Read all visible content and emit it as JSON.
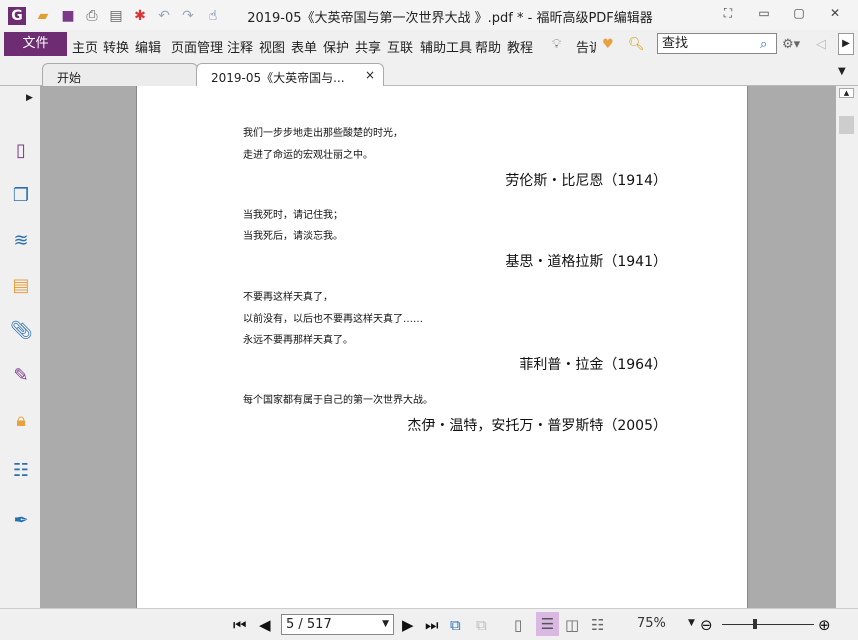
{
  "window": {
    "title": "2019-05《大英帝国与第一次世界大战 》.pdf * - 福昕高级PDF编辑器"
  },
  "quick_access": [
    "app-logo-icon",
    "open-icon",
    "save-icon",
    "print-icon",
    "properties-icon",
    "new-icon",
    "undo-icon",
    "redo-icon",
    "hand-tool-icon"
  ],
  "menu": {
    "file": "文件",
    "items": [
      "主页",
      "转换",
      "编辑",
      "页面管理",
      "注释",
      "视图",
      "表单",
      "保护",
      "共享",
      "互联",
      "辅助工具",
      "帮助",
      "教程"
    ],
    "tell": "告诉",
    "search_placeholder": "查找"
  },
  "tabs": [
    {
      "label": "开始"
    },
    {
      "label": "2019-05《大英帝国与...",
      "close": "×"
    }
  ],
  "sidebar": [
    "page-thumbnail-icon",
    "pages-icon",
    "layers-icon",
    "comments-icon",
    "attachments-icon",
    "signature-icon",
    "security-icon",
    "form-fields-icon",
    "certify-icon"
  ],
  "content": {
    "blocks": [
      {
        "lines": [
          "我们一步步地走出那些酸楚的时光，",
          "走进了命运的宏观壮丽之中。"
        ],
        "author": "劳伦斯・比尼恩（1914）"
      },
      {
        "lines": [
          "当我死时，请记住我；",
          "当我死后，请淡忘我。"
        ],
        "author": "基思・道格拉斯（1941）"
      },
      {
        "lines": [
          "不要再这样天真了，",
          "以前没有，以后也不要再这样天真了……",
          "永远不要再那样天真了。"
        ],
        "author": "菲利普・拉金（1964）"
      },
      {
        "lines": [
          "每个国家都有属于自己的第一次世界大战。"
        ],
        "author": "杰伊・温特，安托万・普罗斯特（2005）"
      }
    ]
  },
  "status": {
    "page": "5 / 517",
    "zoom": "75%",
    "accent": "#6e2c72"
  }
}
